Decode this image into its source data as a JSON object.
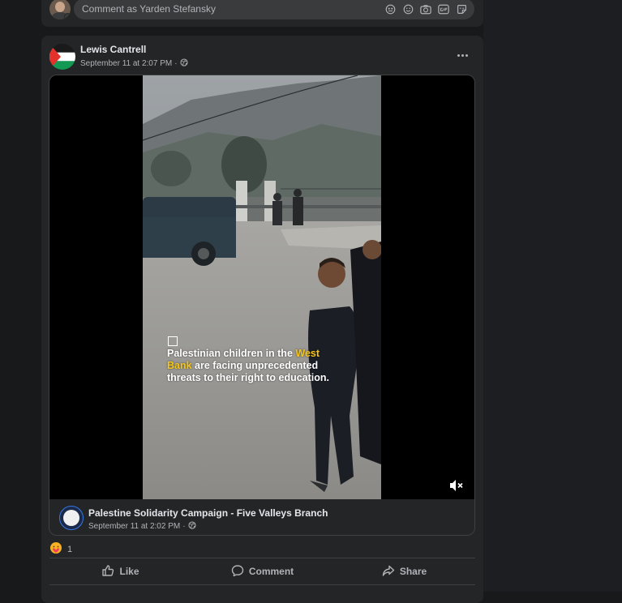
{
  "comment_bar": {
    "placeholder": "Comment as Yarden Stefansky",
    "icons": [
      "avatar-sticker-icon",
      "emoji-icon",
      "camera-icon",
      "gif-icon",
      "sticker-icon"
    ]
  },
  "post": {
    "author": "Lewis Cantrell",
    "timestamp": "September 11 at 2:07 PM",
    "audience_icon": "globe-icon",
    "shared_video": {
      "caption_part1": "Palestinian children in the ",
      "caption_highlight1": "West",
      "caption_highlight2": "Bank",
      "caption_part2": " are facing unprecedented",
      "caption_part3": "threats to their right to education.",
      "highlight_color": "#f5c518"
    },
    "shared_source": {
      "page_name": "Palestine Solidarity Campaign - Five Valleys Branch",
      "timestamp": "September 11 at 2:02 PM"
    },
    "reaction_count": "1",
    "actions": {
      "like": "Like",
      "comment": "Comment",
      "share": "Share"
    }
  }
}
